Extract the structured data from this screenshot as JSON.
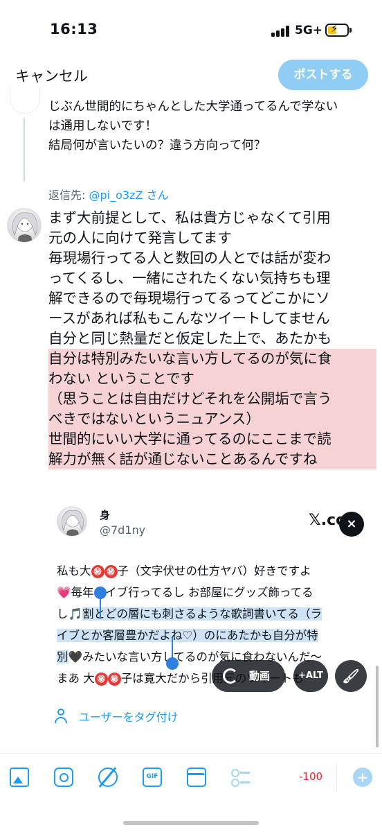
{
  "status_bar": {
    "time": "16:13",
    "network": "5G+"
  },
  "nav": {
    "cancel": "キャンセル",
    "post": "ポストする"
  },
  "previous_tweet": {
    "lines": [
      "じぶん世間的にちゃんとした大学通ってるんで学ない",
      "は通用しないです！",
      "結局何が言いたいの？違う方向って何？"
    ]
  },
  "reply_to": {
    "prefix": "返信先: ",
    "handle": "@pi_o3zZ",
    "suffix": " さん"
  },
  "compose": {
    "lines": [
      "まず大前提として、私は貴方じゃなくて引用",
      "元の人に向けて発言してます",
      "毎現場行ってる人と数回の人とでは話が変わ",
      "ってくるし、一緒にされたくない気持ちも理",
      "解できるので毎現場行ってるってどこかにソ",
      "ースがあれば私もこんなツイートしてません",
      "自分と同じ熱量だと仮定した上で、あたかも"
    ],
    "highlighted_lines": [
      "自分は特別みたいな言い方してるのが気に食",
      "わない ということです",
      "（思うことは自由だけどそれを公開垢で言う",
      "べきではないというニュアンス）",
      "世間的にいい大学に通ってるのにここまで読",
      "解力が無く話が通じないことあるんですね"
    ]
  },
  "quoted": {
    "name": "身",
    "handle": "@7d1ny",
    "source": "𝕏.co",
    "close": "×",
    "maru": "㊙",
    "line1_a": "私も大",
    "line1_b": "子（文字伏せの仕方ヤバ）好きですよ",
    "line2": "💗毎年ライブ行ってるし お部屋にグッズ飾ってる",
    "line3_a": "し🎵",
    "line3_b": "割とどの層にも刺さるような歌詞書いてる（ラ",
    "line4": "イブとか客層豊かだよね♡）のにあたかも自分が特",
    "line5_a": "別",
    "line5_b": "🖤みたいな言い方してるのが気に食わないんだ〜",
    "line6_a": "まあ 大",
    "line6_b": "子は寛大だから引用元のツイートも"
  },
  "media_actions": {
    "video": "動画",
    "alt": "+ALT",
    "edit": "🖌"
  },
  "tag_users": "ユーザーをタグ付け",
  "toolbar": {
    "gif": "GIF",
    "counter": "-100",
    "add": "+"
  },
  "colors": {
    "accent": "#1d9bf0",
    "highlight": "#f6d2d5",
    "selection": "#cfe3f7",
    "over_limit": "#f4212e"
  }
}
